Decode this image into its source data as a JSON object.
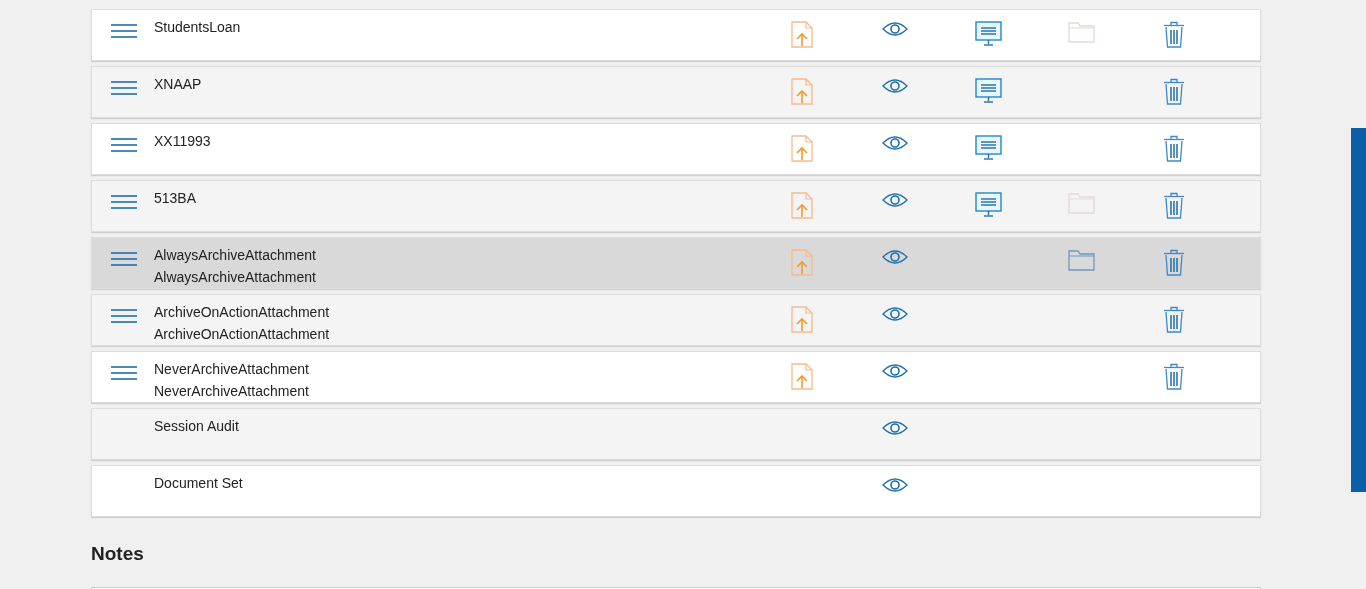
{
  "rows": [
    {
      "lines": [
        "StudentsLoan"
      ],
      "handle": true,
      "upload": true,
      "view": true,
      "present": true,
      "folder": true,
      "folder_dimmed": true,
      "trash": true,
      "selected": false
    },
    {
      "lines": [
        "XNAAP"
      ],
      "handle": true,
      "upload": true,
      "view": true,
      "present": true,
      "folder": false,
      "trash": true,
      "selected": false
    },
    {
      "lines": [
        "XX11993"
      ],
      "handle": true,
      "upload": true,
      "view": true,
      "present": true,
      "folder": false,
      "trash": true,
      "selected": false
    },
    {
      "lines": [
        "513BA"
      ],
      "handle": true,
      "upload": true,
      "view": true,
      "present": true,
      "folder": true,
      "folder_dimmed": true,
      "trash": true,
      "selected": false
    },
    {
      "lines": [
        "AlwaysArchiveAttachment",
        "AlwaysArchiveAttachment"
      ],
      "handle": true,
      "upload": true,
      "view": true,
      "present": false,
      "folder": true,
      "folder_dimmed": false,
      "trash": true,
      "selected": true
    },
    {
      "lines": [
        "ArchiveOnActionAttachment",
        "ArchiveOnActionAttachment"
      ],
      "handle": true,
      "upload": true,
      "view": true,
      "present": false,
      "folder": false,
      "trash": true,
      "selected": false
    },
    {
      "lines": [
        "NeverArchiveAttachment",
        "NeverArchiveAttachment"
      ],
      "handle": true,
      "upload": true,
      "view": true,
      "present": false,
      "folder": false,
      "trash": true,
      "selected": false
    },
    {
      "lines": [
        "Session Audit"
      ],
      "handle": false,
      "upload": false,
      "view": true,
      "present": false,
      "folder": false,
      "trash": false,
      "selected": false
    },
    {
      "lines": [
        "Document Set"
      ],
      "handle": false,
      "upload": false,
      "view": true,
      "present": false,
      "folder": false,
      "trash": false,
      "selected": false
    }
  ],
  "notes": {
    "heading": "Notes"
  }
}
